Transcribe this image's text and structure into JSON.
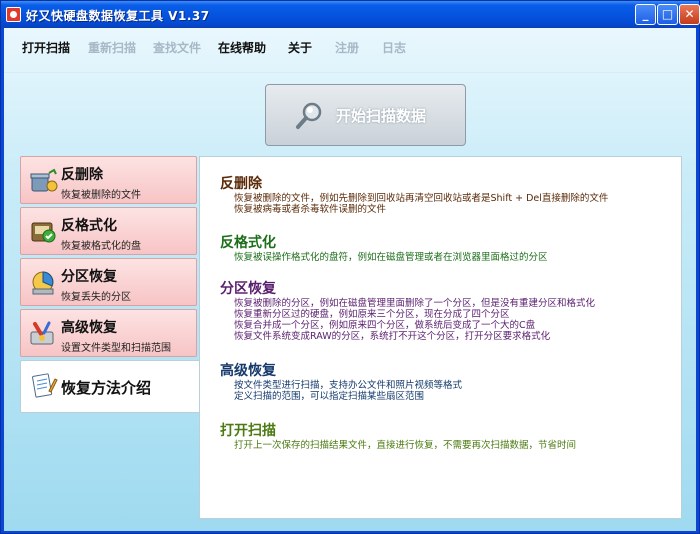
{
  "window": {
    "title": "好又快硬盘数据恢复工具  V1.37",
    "buttons": {
      "minimize": "_",
      "maximize": "□",
      "close": "✕"
    }
  },
  "menu": [
    {
      "label": "打开扫描",
      "enabled": true
    },
    {
      "label": "重新扫描",
      "enabled": false
    },
    {
      "label": "查找文件",
      "enabled": false
    },
    {
      "label": "在线帮助",
      "enabled": true
    },
    {
      "label": "关于",
      "enabled": true
    },
    {
      "label": "注册",
      "enabled": false
    },
    {
      "label": "日志",
      "enabled": false
    }
  ],
  "scan_button": {
    "label": "开始扫描数据",
    "icon": "magnifier-icon"
  },
  "sidebar": [
    {
      "title": "反删除",
      "subtitle": "恢复被删除的文件",
      "icon": "recycle-bin-icon"
    },
    {
      "title": "反格式化",
      "subtitle": "恢复被格式化的盘",
      "icon": "disk-check-icon"
    },
    {
      "title": "分区恢复",
      "subtitle": "恢复丢失的分区",
      "icon": "partition-icon"
    },
    {
      "title": "高级恢复",
      "subtitle": "设置文件类型和扫描范围",
      "icon": "tools-icon"
    },
    {
      "title": "恢复方法介绍",
      "subtitle": "",
      "icon": "notepad-icon",
      "active": true
    }
  ],
  "content": {
    "sections": [
      {
        "title": "反删除",
        "color": "#5a2a08",
        "lines": [
          "恢复被删除的文件，例如先删除到回收站再清空回收站或者是Shift + Del直接删除的文件",
          "恢复被病毒或者杀毒软件误删的文件"
        ]
      },
      {
        "title": "反格式化",
        "color": "#1d6e1a",
        "lines": [
          "恢复被误操作格式化的盘符，例如在磁盘管理或者在浏览器里面格过的分区"
        ]
      },
      {
        "title": "分区恢复",
        "color": "#5a1f6e",
        "lines": [
          "恢复被删除的分区，例如在磁盘管理里面删除了一个分区，但是没有重建分区和格式化",
          "恢复重新分区过的硬盘，例如原来三个分区，现在分成了四个分区",
          "恢复合并成一个分区，例如原来四个分区，做系统后变成了一个大的C盘",
          "恢复文件系统变成RAW的分区，系统打不开这个分区，打开分区要求格式化"
        ]
      },
      {
        "title": "高级恢复",
        "color": "#153a6b",
        "lines": [
          "按文件类型进行扫描，支持办公文件和照片视频等格式",
          "定义扫描的范围，可以指定扫描某些扇区范围"
        ]
      },
      {
        "title": "打开扫描",
        "color": "#4c7a12",
        "lines": [
          "打开上一次保存的扫描结果文件，直接进行恢复，不需要再次扫描数据，节省时间"
        ]
      }
    ]
  }
}
